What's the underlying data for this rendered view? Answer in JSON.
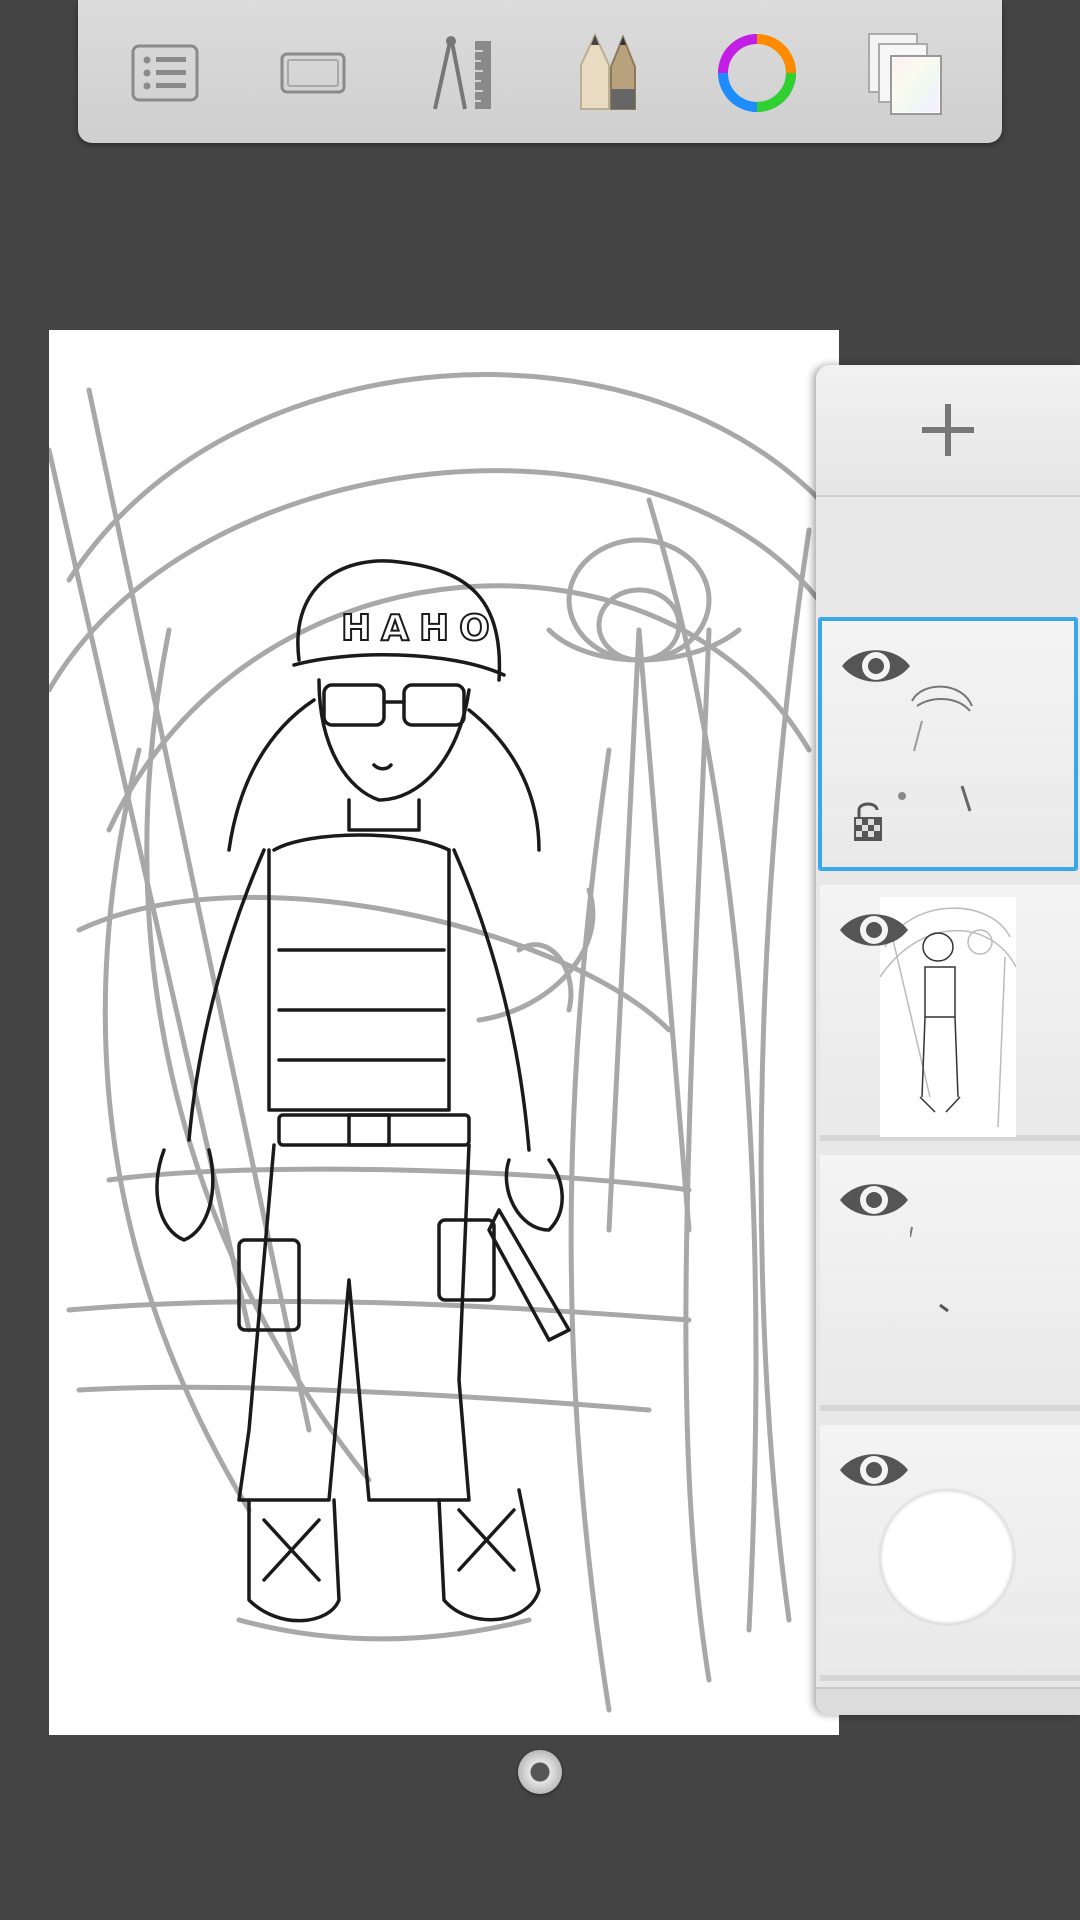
{
  "toolbar": {
    "tools": [
      {
        "name": "menu",
        "icon": "list-icon"
      },
      {
        "name": "canvas-frame",
        "icon": "frame-icon"
      },
      {
        "name": "guides",
        "icon": "compass-ruler-icon"
      },
      {
        "name": "brushes",
        "icon": "pencils-icon"
      },
      {
        "name": "color",
        "icon": "color-wheel-icon"
      },
      {
        "name": "layers",
        "icon": "layers-stack-icon"
      }
    ]
  },
  "canvas": {
    "helmet_text": "HAHO"
  },
  "layers_panel": {
    "add_icon": "plus-icon",
    "selected_color": "#3aa7e8",
    "layers": [
      {
        "name": "layer-1",
        "visible": true,
        "selected": true,
        "locked_transparency": true
      },
      {
        "name": "layer-2",
        "visible": true,
        "selected": false
      },
      {
        "name": "layer-3",
        "visible": true,
        "selected": false
      },
      {
        "name": "layer-4-background",
        "visible": true,
        "selected": false
      }
    ]
  }
}
